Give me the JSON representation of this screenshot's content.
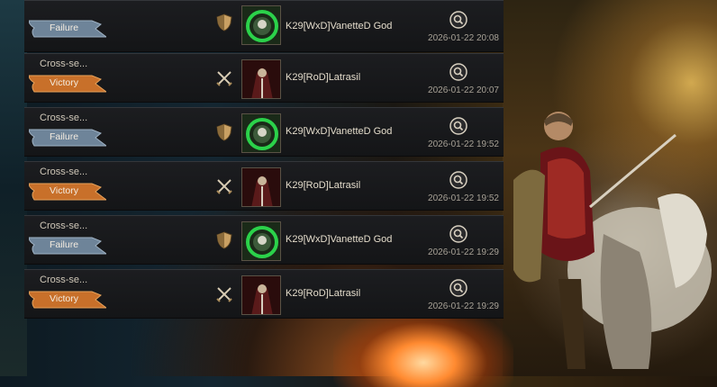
{
  "rows": [
    {
      "mode": "",
      "result": "Failure",
      "kind": "defense",
      "player": "K29[WxD]VanetteD God",
      "time": "2026-01-22 20:08",
      "avatar": "green-emblem"
    },
    {
      "mode": "Cross-se...",
      "result": "Victory",
      "kind": "attack",
      "player": "K29[RoD]Latrasil",
      "time": "2026-01-22 20:07",
      "avatar": "red-warrior"
    },
    {
      "mode": "Cross-se...",
      "result": "Failure",
      "kind": "defense",
      "player": "K29[WxD]VanetteD God",
      "time": "2026-01-22 19:52",
      "avatar": "green-emblem"
    },
    {
      "mode": "Cross-se...",
      "result": "Victory",
      "kind": "attack",
      "player": "K29[RoD]Latrasil",
      "time": "2026-01-22 19:52",
      "avatar": "red-warrior"
    },
    {
      "mode": "Cross-se...",
      "result": "Failure",
      "kind": "defense",
      "player": "K29[WxD]VanetteD God",
      "time": "2026-01-22 19:29",
      "avatar": "green-emblem"
    },
    {
      "mode": "Cross-se...",
      "result": "Victory",
      "kind": "attack",
      "player": "K29[RoD]Latrasil",
      "time": "2026-01-22 19:29",
      "avatar": "red-warrior"
    }
  ],
  "colors": {
    "victory": "#c8702a",
    "failure": "#6e8499",
    "accent": "#c9a063"
  }
}
